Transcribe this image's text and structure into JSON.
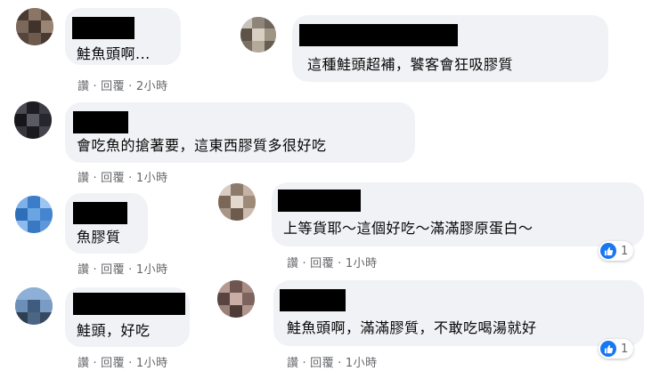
{
  "actions": {
    "like": "讚",
    "reply": "回覆",
    "separator": "·"
  },
  "comments": [
    {
      "text": "鮭魚頭啊...",
      "time": "2小時"
    },
    {
      "text": "這種鮭頭超補，饕客會狂吸膠質"
    },
    {
      "text": "會吃魚的搶著要，這東西膠質多很好吃",
      "time": "1小時"
    },
    {
      "text": "魚膠質",
      "time": "1小時"
    },
    {
      "text": "上等貨耶～這個好吃～滿滿膠原蛋白～",
      "time": "1小時",
      "reactions": "1"
    },
    {
      "text": "鮭頭，好吃",
      "time": "1小時"
    },
    {
      "text": "鮭魚頭啊，滿滿膠質，不敢吃喝湯就好",
      "time": "1小時",
      "reactions": "1"
    }
  ],
  "colors": {
    "bubble": "#f0f2f5",
    "meta_text": "#65676b",
    "like_blue": "#1877f2",
    "redaction": "#000000"
  },
  "icons": {
    "like": "thumbs-up-icon"
  }
}
